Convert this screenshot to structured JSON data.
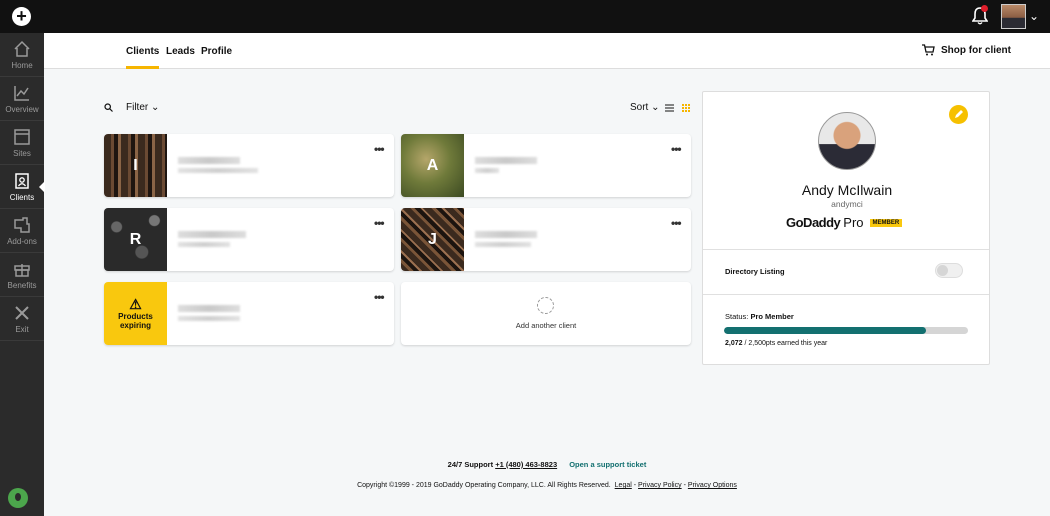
{
  "topbar": {
    "plus_icon": "plus-circle-icon",
    "bell_icon": "bell-icon",
    "user_menu_chevron": "chevron-down-icon"
  },
  "sidebar": {
    "items": [
      {
        "label": "Home",
        "icon": "home-icon"
      },
      {
        "label": "Overview",
        "icon": "chart-line-icon"
      },
      {
        "label": "Sites",
        "icon": "browser-window-icon"
      },
      {
        "label": "Clients",
        "icon": "contact-card-icon"
      },
      {
        "label": "Add-ons",
        "icon": "plug-icon"
      },
      {
        "label": "Benefits",
        "icon": "gift-icon"
      },
      {
        "label": "Exit",
        "icon": "close-icon"
      }
    ],
    "active": "Clients"
  },
  "tabs": [
    {
      "label": "Clients",
      "active": true
    },
    {
      "label": "Leads",
      "active": false
    },
    {
      "label": "Profile",
      "active": false
    }
  ],
  "shop_label": "Shop for client",
  "toolbar": {
    "filter_label": "Filter",
    "sort_label": "Sort"
  },
  "clients": [
    {
      "initial": "I",
      "thumb": "wood"
    },
    {
      "initial": "A",
      "thumb": "grass"
    },
    {
      "initial": "R",
      "thumb": "stones"
    },
    {
      "initial": "J",
      "thumb": "wood"
    },
    {
      "initial": "",
      "thumb": "warning",
      "warning_line1": "Products",
      "warning_line2": "expiring"
    }
  ],
  "add_client_label": "Add another client",
  "profile": {
    "name": "Andy McIlwain",
    "username": "andymci",
    "brand_bold": "GoDaddy",
    "brand_light": "Pro",
    "badge": "MEMBER",
    "directory_label": "Directory Listing",
    "directory_enabled": false,
    "status_prefix": "Status:",
    "status_value": "Pro Member",
    "points_current": "2,072",
    "points_rest": " / 2,500pts earned this year",
    "progress_fraction": 0.829
  },
  "footer": {
    "support_label": "24/7 Support",
    "phone": "+1 (480) 463-8823",
    "ticket_link": "Open a support ticket",
    "copyright": "Copyright ©1999 - 2019 GoDaddy Operating Company, LLC. All Rights Reserved.",
    "legal": "Legal",
    "privacy_policy": "Privacy Policy",
    "privacy_options": "Privacy Options",
    "sep": "-"
  },
  "colors": {
    "accent_yellow": "#f6b500",
    "teal": "#137070",
    "sidebar_bg": "#2b2b2b"
  }
}
